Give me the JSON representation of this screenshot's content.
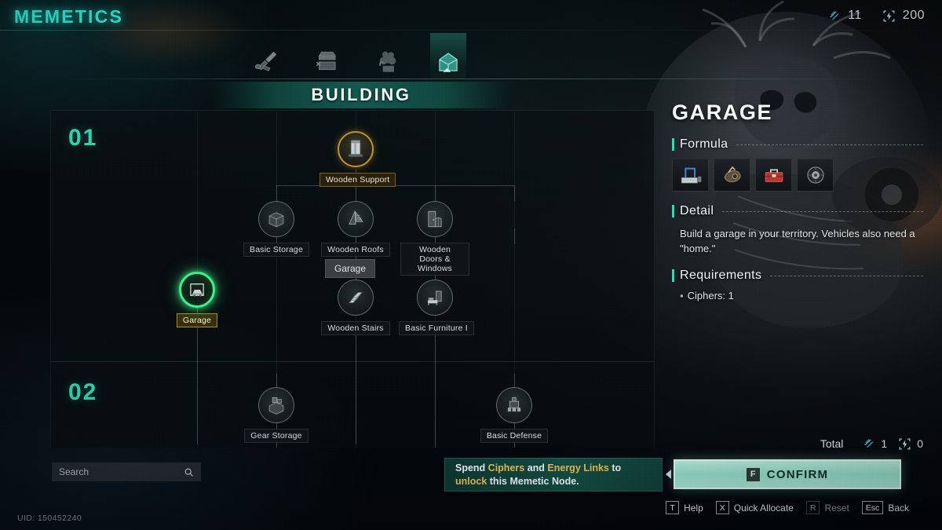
{
  "app": {
    "title": "MEMETICS",
    "uid": "UID: 150452240"
  },
  "currencies": [
    {
      "icon": "cipher-icon",
      "value": "11"
    },
    {
      "icon": "energy-link-icon",
      "value": "200"
    }
  ],
  "categories": [
    {
      "icon": "weapon-category-icon",
      "name": "weapons",
      "active": false
    },
    {
      "icon": "workbench-category-icon",
      "name": "crafting",
      "active": false
    },
    {
      "icon": "farming-category-icon",
      "name": "farming",
      "active": false
    },
    {
      "icon": "building-category-icon",
      "name": "building",
      "active": true
    }
  ],
  "section": {
    "title": "BUILDING"
  },
  "tiers": [
    {
      "number": "01"
    },
    {
      "number": "02"
    }
  ],
  "nodes": [
    {
      "id": "wooden-support",
      "label": "Wooden Support",
      "state": "unlocked",
      "icon": "wooden-support-icon"
    },
    {
      "id": "basic-storage",
      "label": "Basic Storage",
      "state": "locked",
      "icon": "basic-storage-icon"
    },
    {
      "id": "wooden-roofs",
      "label": "Wooden Roofs",
      "state": "locked",
      "icon": "wooden-roofs-icon"
    },
    {
      "id": "wooden-doors",
      "label": "Wooden Doors & Windows",
      "state": "locked",
      "icon": "wooden-doors-icon"
    },
    {
      "id": "garage",
      "label": "Garage",
      "state": "selected",
      "icon": "garage-icon"
    },
    {
      "id": "wooden-stairs",
      "label": "Wooden Stairs",
      "state": "locked",
      "icon": "wooden-stairs-icon"
    },
    {
      "id": "basic-furniture",
      "label": "Basic Furniture I",
      "state": "locked",
      "icon": "basic-furniture-icon"
    },
    {
      "id": "gear-storage",
      "label": "Gear Storage",
      "state": "locked",
      "icon": "gear-storage-icon"
    },
    {
      "id": "basic-defense",
      "label": "Basic Defense",
      "state": "locked",
      "icon": "basic-defense-icon"
    }
  ],
  "tooltip_chip": {
    "label": "Garage"
  },
  "search": {
    "placeholder": "Search",
    "value": "",
    "icon": "search-icon"
  },
  "hint": {
    "part1": "Spend ",
    "hl1": "Ciphers",
    "part2": " and ",
    "hl2": "Energy Links",
    "part3": " to ",
    "hl3": "unlock",
    "part4": " this Memetic Node."
  },
  "detail": {
    "title": "GARAGE",
    "formula_heading": "Formula",
    "formula_slots": [
      {
        "icon": "vehicle-lift-icon"
      },
      {
        "icon": "engine-part-icon"
      },
      {
        "icon": "toolbox-icon"
      },
      {
        "icon": "wheel-icon"
      }
    ],
    "detail_heading": "Detail",
    "detail_text": "Build a garage in your territory. Vehicles also need a \"home.\"",
    "requirements_heading": "Requirements",
    "requirements": [
      "Ciphers:  1"
    ]
  },
  "total": {
    "label": "Total",
    "ciphers": "1",
    "energy_links": "0"
  },
  "confirm": {
    "key": "F",
    "label": "CONFIRM"
  },
  "key_hints": [
    {
      "key": "T",
      "label": "Help",
      "disabled": false
    },
    {
      "key": "X",
      "label": "Quick Allocate",
      "disabled": false
    },
    {
      "key": "R",
      "label": "Reset",
      "disabled": true
    },
    {
      "key": "Esc",
      "label": "Back",
      "disabled": false
    }
  ],
  "colors": {
    "accent_cyan": "#36f0dc",
    "tier_green": "#2fd3ad",
    "selected_green": "#3ef08a",
    "unlocked_gold": "#b9912f",
    "highlight_gold": "#e8bf52",
    "confirm_mint": "#92ddc9"
  }
}
